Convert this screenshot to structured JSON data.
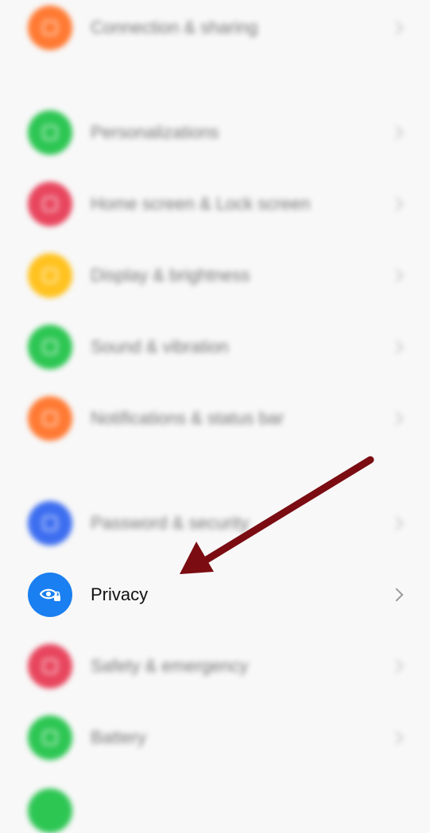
{
  "settings": {
    "items": [
      {
        "label": "Connection & sharing",
        "color": "#ff7a33",
        "icon": "connection-icon",
        "blurred": true
      },
      {
        "label": "Personalizations",
        "color": "#2dc653",
        "icon": "personalization-icon",
        "blurred": true
      },
      {
        "label": "Home screen & Lock screen",
        "color": "#e8465e",
        "icon": "home-screen-icon",
        "blurred": true
      },
      {
        "label": "Display & brightness",
        "color": "#ffc21f",
        "icon": "display-icon",
        "blurred": true
      },
      {
        "label": "Sound & vibration",
        "color": "#2dc653",
        "icon": "sound-icon",
        "blurred": true
      },
      {
        "label": "Notifications & status bar",
        "color": "#ff7a33",
        "icon": "notifications-icon",
        "blurred": true
      },
      {
        "label": "Password & security",
        "color": "#3d6ef0",
        "icon": "password-icon",
        "blurred": true
      },
      {
        "label": "Privacy",
        "color": "#1a7ff0",
        "icon": "privacy-eye-icon",
        "blurred": false
      },
      {
        "label": "Safety & emergency",
        "color": "#e8465e",
        "icon": "safety-icon",
        "blurred": true
      },
      {
        "label": "Battery",
        "color": "#2dc653",
        "icon": "battery-icon",
        "blurred": true
      }
    ],
    "partial_item_color": "#2dc653"
  },
  "annotation": {
    "arrow_color": "#7a0c12"
  }
}
